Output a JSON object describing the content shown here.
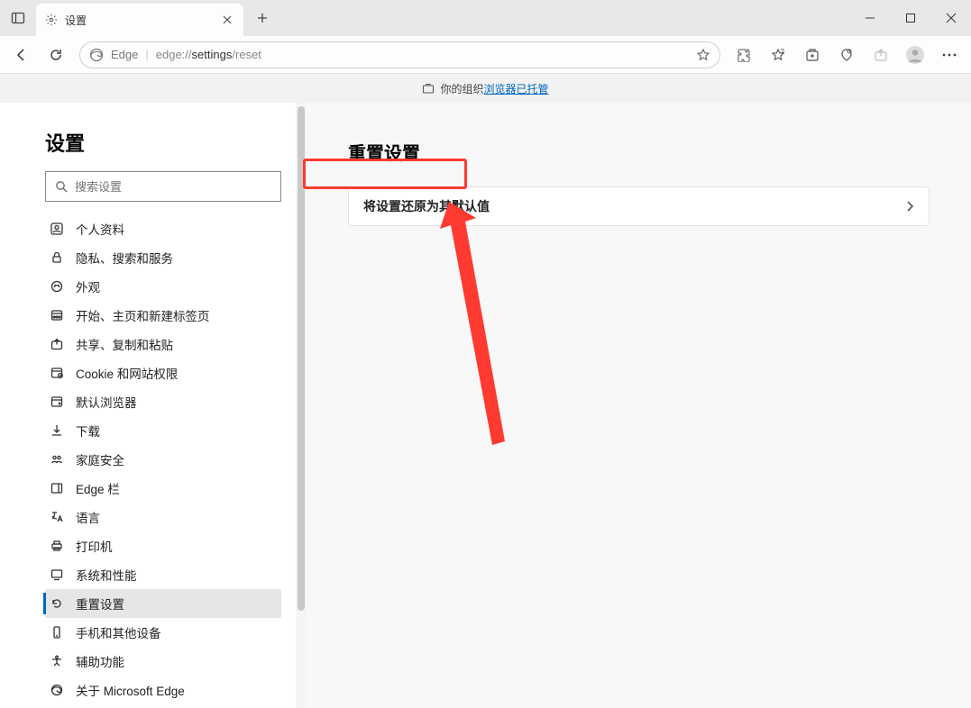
{
  "titlebar": {
    "tab_title": "设置"
  },
  "toolbar": {
    "address_prefix": "Edge",
    "address_url_pre": "edge://",
    "address_url_bold": "settings",
    "address_url_post": "/reset"
  },
  "banner": {
    "pre": "你的组织",
    "link": "浏览器已托管"
  },
  "sidebar": {
    "title": "设置",
    "search_placeholder": "搜索设置",
    "items": [
      {
        "label": "个人资料",
        "icon": "profile-icon"
      },
      {
        "label": "隐私、搜索和服务",
        "icon": "privacy-icon"
      },
      {
        "label": "外观",
        "icon": "appearance-icon"
      },
      {
        "label": "开始、主页和新建标签页",
        "icon": "start-icon"
      },
      {
        "label": "共享、复制和粘贴",
        "icon": "share-icon"
      },
      {
        "label": "Cookie 和网站权限",
        "icon": "cookie-icon"
      },
      {
        "label": "默认浏览器",
        "icon": "default-browser-icon"
      },
      {
        "label": "下载",
        "icon": "download-icon"
      },
      {
        "label": "家庭安全",
        "icon": "family-icon"
      },
      {
        "label": "Edge 栏",
        "icon": "edgebar-icon"
      },
      {
        "label": "语言",
        "icon": "language-icon"
      },
      {
        "label": "打印机",
        "icon": "printer-icon"
      },
      {
        "label": "系统和性能",
        "icon": "system-icon"
      },
      {
        "label": "重置设置",
        "icon": "reset-icon",
        "active": true
      },
      {
        "label": "手机和其他设备",
        "icon": "phone-icon"
      },
      {
        "label": "辅助功能",
        "icon": "accessibility-icon"
      },
      {
        "label": "关于 Microsoft Edge",
        "icon": "edge-logo-icon"
      }
    ]
  },
  "main": {
    "title": "重置设置",
    "reset_option_label": "将设置还原为其默认值"
  }
}
